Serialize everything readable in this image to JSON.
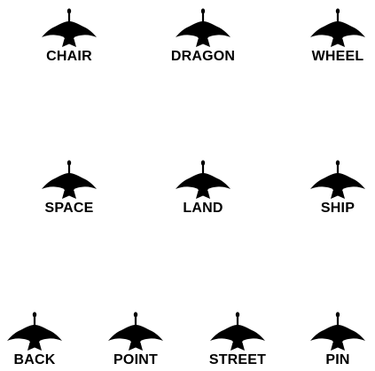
{
  "icon": "bird-silhouette-icon",
  "icon_color": "#000000",
  "items": [
    {
      "label": "CHAIR"
    },
    {
      "label": "DRAGON"
    },
    {
      "label": "WHEEL"
    },
    {
      "label": "SPACE"
    },
    {
      "label": "LAND"
    },
    {
      "label": "SHIP"
    },
    {
      "label": "BACK"
    },
    {
      "label": "POINT"
    },
    {
      "label": "STREET"
    },
    {
      "label": "PIN"
    }
  ]
}
